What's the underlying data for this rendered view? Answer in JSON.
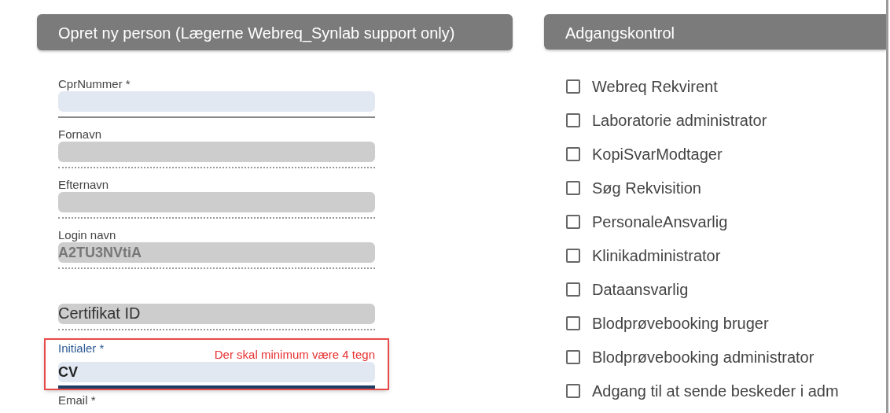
{
  "person_panel": {
    "title": "Opret ny person (Lægerne Webreq_Synlab support only)",
    "fields": [
      {
        "label": "CprNummer *",
        "disabled": false,
        "focused": false
      },
      {
        "label": "Fornavn",
        "disabled": true,
        "focused": false
      },
      {
        "label": "Efternavn",
        "disabled": true,
        "focused": false
      },
      {
        "label": "Login navn",
        "disabled": true,
        "focused": false,
        "value": "A2TU3NVtiA"
      },
      {
        "placeholder": "Certifikat ID",
        "disabled": true,
        "focused": false
      },
      {
        "label": "Initialer *",
        "disabled": false,
        "focused": true,
        "value": "CV",
        "error": "Der skal minimum være 4 tegn"
      },
      {
        "label": "Email *"
      }
    ]
  },
  "access_panel": {
    "title": "Adgangskontrol",
    "roles": [
      {
        "label": "Webreq Rekvirent",
        "checked": false
      },
      {
        "label": "Laboratorie administrator",
        "checked": false
      },
      {
        "label": "KopiSvarModtager",
        "checked": false
      },
      {
        "label": "Søg Rekvisition",
        "checked": false
      },
      {
        "label": "PersonaleAnsvarlig",
        "checked": false
      },
      {
        "label": "Klinikadministrator",
        "checked": false
      },
      {
        "label": "Dataansvarlig",
        "checked": false
      },
      {
        "label": "Blodprøvebooking bruger",
        "checked": false
      },
      {
        "label": "Blodprøvebooking administrator",
        "checked": false
      },
      {
        "label": "Adgang til at sende beskeder i adm",
        "checked": false
      }
    ]
  }
}
